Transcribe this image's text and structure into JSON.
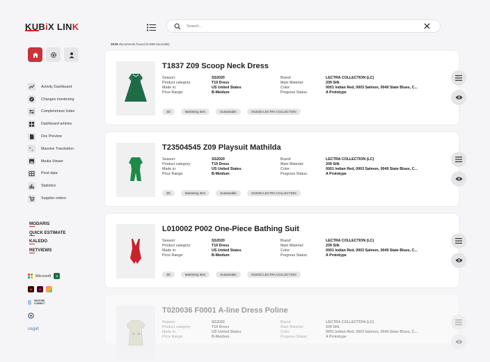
{
  "logo": {
    "part1": "KUB",
    "part2": "i",
    "part3": "X LIN",
    "part4": "K"
  },
  "sidebar": {
    "top_buttons": [
      "home-icon",
      "gear-icon",
      "user-icon"
    ],
    "nav": [
      {
        "label": "Activity Dashboard",
        "icon": "chart-icon"
      },
      {
        "label": "Changes monitoring",
        "icon": "compass-icon"
      },
      {
        "label": "Completeness Index",
        "icon": "sliders-icon"
      },
      {
        "label": "Dashboard articles",
        "icon": "grid-icon"
      },
      {
        "label": "Doc Preview",
        "icon": "document-icon"
      },
      {
        "label": "Massive Translation",
        "icon": "translate-icon"
      },
      {
        "label": "Media Viewer",
        "icon": "image-icon"
      },
      {
        "label": "Pivot data",
        "icon": "table-icon"
      },
      {
        "label": "Statistics",
        "icon": "bars-icon"
      },
      {
        "label": "Supplier orders",
        "icon": "cart-icon"
      }
    ],
    "partners": [
      "MODARIS",
      "QUICK ESTIMATE",
      "KALEDO",
      "RETVIEWS"
    ],
    "brands": {
      "microsoft": "Microsoft",
      "pantone": "PANTONE CONNECT",
      "cegid": "cegid",
      "adobe": [
        "Ai",
        "Id"
      ]
    }
  },
  "search": {
    "placeholder": "Search..."
  },
  "results": {
    "count": "2039",
    "text": "documents found (0.599 seconds)"
  },
  "labels": {
    "season": "Season:",
    "category": "Product category:",
    "made_in": "Made in:",
    "price": "Price Range:",
    "brand": "Brand:",
    "material": "Main Material:",
    "color": "Color:",
    "progress": "Progress Status:"
  },
  "cards": [
    {
      "title": "T1837 Z09 Scoop Neck Dress",
      "season": "SS2020",
      "category": "T19 Dress",
      "made_in": "US United States",
      "price": "B-Meidum",
      "brand": "LECTRA COLLECTION (LC)",
      "material": "209 Silk",
      "color": "0001 Indian Red, 0003 Salmon, 0049 State Blues, C...",
      "progress": "A Prototype",
      "tags": [
        "3D",
        "Marketing item",
        "Sustainable",
        "SS2020 LECTRA COLLECTION"
      ],
      "thumb_color": "#1f6b48"
    },
    {
      "title": "T23504545 Z09 Playsuit Mathilda",
      "season": "SS2020",
      "category": "T19 Dress",
      "made_in": "US United States",
      "price": "B-Meidum",
      "brand": "LECTRA COLLECTION (LC)",
      "material": "209 Silk",
      "color": "0001 Indian Red, 0003 Salmon, 0049 State Blues, C...",
      "progress": "A Prototype",
      "tags": [
        "3D",
        "Marketing item",
        "Sustainable",
        "SS2020 LECTRA COLLECTION"
      ],
      "thumb_color": "#1e8a4a"
    },
    {
      "title": "L010002 P002 One-Piece Bathing Suit",
      "season": "SS2020",
      "category": "T19 Dress",
      "made_in": "US United States",
      "price": "B-Meidum",
      "brand": "LECTRA COLLECTION (LC)",
      "material": "209 Silk",
      "color": "0001 Indian Red, 0003 Salmon, 0049 State Blues, C...",
      "progress": "A Prototype",
      "tags": [
        "3D",
        "Marketing item",
        "Sustainable",
        "SS2020 LECTRA COLLECTION"
      ],
      "thumb_color": "#c8232c"
    },
    {
      "title": "T020036 F0001 A-line Dress Poline",
      "season": "SS2020",
      "category": "T19 Dress",
      "made_in": "US United States",
      "price": "B-Meidum",
      "brand": "LECTRA COLLECTION (LC)",
      "material": "209 Silk",
      "color": "0001 Indian Red, 0003 Salmon, 0049 State Blues, C...",
      "progress": "A Prototype",
      "tags": [],
      "thumb_color": "#c9c9a8"
    }
  ],
  "colors": {
    "accent": "#d2232a",
    "home_active": "#c9343a"
  }
}
